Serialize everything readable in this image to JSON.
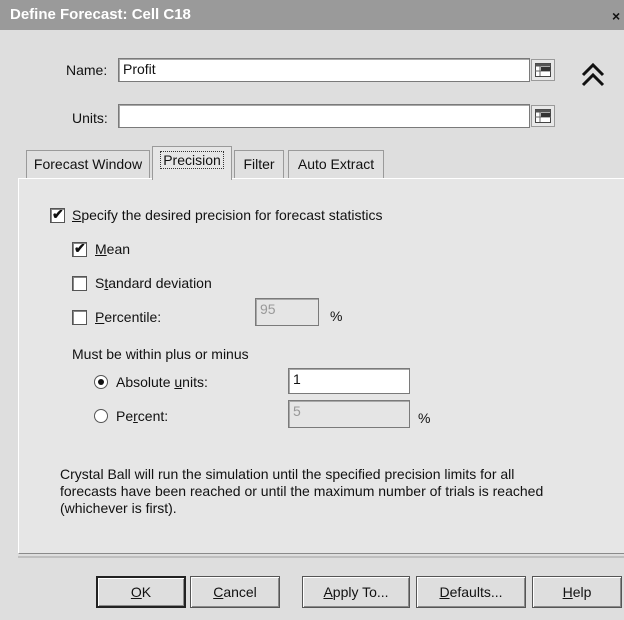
{
  "window": {
    "title": "Define Forecast: Cell C18",
    "close_glyph": "×"
  },
  "name": {
    "label": "Name:",
    "value": "Profit",
    "cell_icon": "cell-reference-icon",
    "collapse_icon": "double-chevron-up-icon"
  },
  "units": {
    "label": "Units:",
    "value": "",
    "cell_icon": "cell-reference-icon"
  },
  "tabs": [
    {
      "label": "Forecast Window",
      "active": false
    },
    {
      "label": "Precision",
      "active": true
    },
    {
      "label": "Filter",
      "active": false
    },
    {
      "label": "Auto Extract",
      "active": false
    }
  ],
  "precision": {
    "specify": {
      "label": "Specify the desired precision for forecast statistics",
      "checked": true
    },
    "mean": {
      "label": "Mean",
      "checked": true
    },
    "std_dev": {
      "label": "Standard deviation",
      "checked": false
    },
    "percentile": {
      "label": "Percentile:",
      "checked": false,
      "value": "95",
      "unit": "%"
    },
    "within_label": "Must be within plus or minus",
    "absolute": {
      "label": "Absolute units:",
      "selected": true,
      "value": "1"
    },
    "percent": {
      "label": "Percent:",
      "selected": false,
      "value": "5",
      "unit": "%"
    },
    "note": "Crystal Ball will run the simulation until the specified precision limits for all forecasts have been reached or until the maximum number of trials is reached (whichever is first)."
  },
  "buttons": {
    "ok": "OK",
    "cancel": "Cancel",
    "apply_to": "Apply To...",
    "defaults": "Defaults...",
    "help": "Help"
  }
}
